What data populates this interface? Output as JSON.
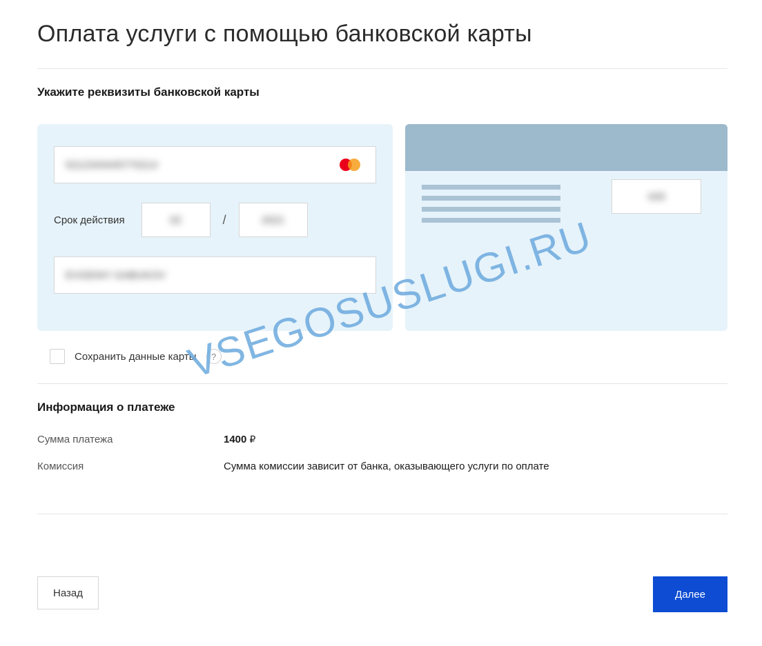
{
  "pageTitle": "Оплата услуги с помощью банковской карты",
  "cardSection": {
    "heading": "Укажите реквизиты банковской карты",
    "cardNumber": "5212343445770214",
    "expiryLabel": "Срок действия",
    "expiryMonth": "02",
    "expiryYear": "2021",
    "cardholder": "EVGENIY GABUKOV",
    "cvv": "429",
    "saveCardLabel": "Сохранить данные карты",
    "helpSymbol": "?"
  },
  "paymentInfo": {
    "heading": "Информация о платеже",
    "amountLabel": "Сумма платежа",
    "amountValue": "1400",
    "currency": "₽",
    "commissionLabel": "Комиссия",
    "commissionValue": "Сумма комиссии зависит от банка, оказывающего услуги по оплате"
  },
  "buttons": {
    "back": "Назад",
    "next": "Далее"
  },
  "separator": "/",
  "watermark": "VSEGOSUSLUGI.RU"
}
